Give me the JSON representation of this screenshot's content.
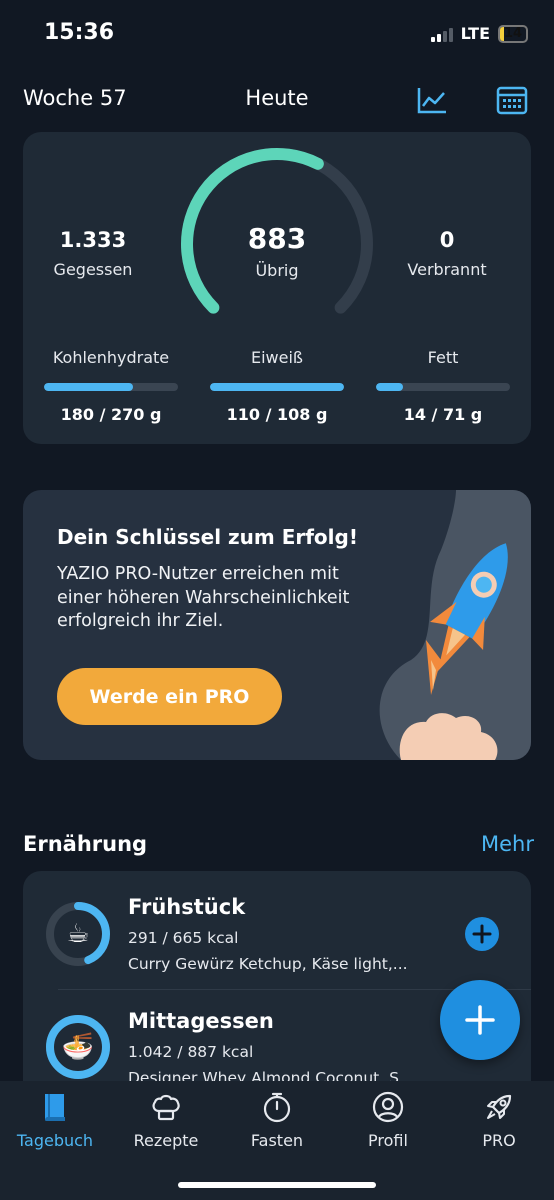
{
  "status_bar": {
    "time": "15:36",
    "network": "LTE",
    "battery": "14",
    "battery_level": 0.14
  },
  "header": {
    "week": "Woche 57",
    "title": "Heute",
    "chart_icon": "line-chart-icon",
    "calendar_icon": "calendar-icon"
  },
  "summary": {
    "eaten_value": "1.333",
    "eaten_label": "Gegessen",
    "remaining_value": "883",
    "remaining_label": "Übrig",
    "burned_value": "0",
    "burned_label": "Verbrannt",
    "ring_progress": 0.6,
    "macros": [
      {
        "name": "Kohlenhydrate",
        "value": "180 / 270 g",
        "progress": 0.667
      },
      {
        "name": "Eiweiß",
        "value": "110 / 108 g",
        "progress": 1.0
      },
      {
        "name": "Fett",
        "value": "14 / 71 g",
        "progress": 0.2
      }
    ]
  },
  "promo": {
    "title": "Dein Schlüssel zum Erfolg!",
    "text": "YAZIO PRO-Nutzer erreichen mit einer höheren Wahrscheinlichkeit erfolgreich ihr Ziel.",
    "button": "Werde ein PRO"
  },
  "nutrition": {
    "title": "Ernährung",
    "more": "Mehr",
    "meals": [
      {
        "name": "Frühstück",
        "kcal": "291 / 665 kcal",
        "items": "Curry Gewürz Ketchup, Käse light,...",
        "progress": 0.44,
        "emoji": "☕"
      },
      {
        "name": "Mittagessen",
        "kcal": "1.042 / 887 kcal",
        "items": "Designer Whey Almond Coconut, S...",
        "progress": 1.0,
        "emoji": "🍜"
      }
    ]
  },
  "nav": {
    "items": [
      {
        "label": "Tagebuch",
        "icon": "diary-book-icon",
        "active": true
      },
      {
        "label": "Rezepte",
        "icon": "chef-hat-icon",
        "active": false
      },
      {
        "label": "Fasten",
        "icon": "stopwatch-icon",
        "active": false
      },
      {
        "label": "Profil",
        "icon": "profile-person-icon",
        "active": false
      },
      {
        "label": "PRO",
        "icon": "rocket-icon",
        "active": false
      }
    ]
  },
  "colors": {
    "background": "#111823",
    "card": "#1f2a36",
    "accent_blue": "#4db6f2",
    "ring_green": "#5dd5b9",
    "promo_button": "#f2a93b"
  }
}
